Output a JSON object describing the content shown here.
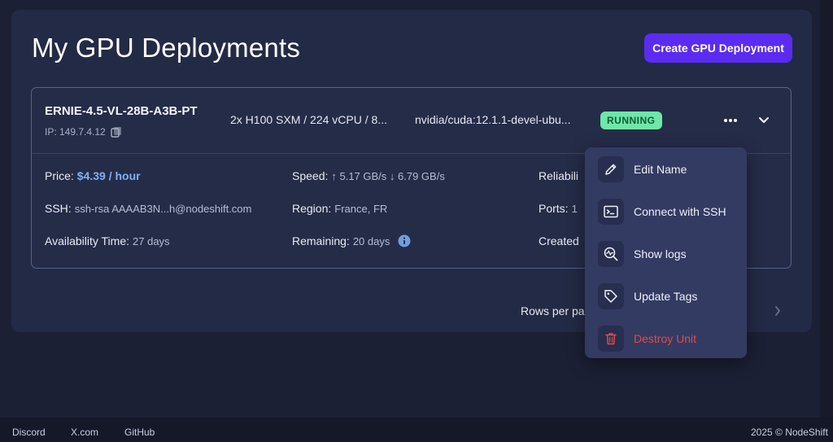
{
  "page": {
    "title": "My GPU Deployments",
    "create_button": "Create GPU Deployment"
  },
  "deployment": {
    "name": "ERNIE-4.5-VL-28B-A3B-PT",
    "ip": "IP: 149.7.4.12",
    "gpu_spec": "2x H100 SXM / 224 vCPU / 8...",
    "image": "nvidia/cuda:12.1.1-devel-ubu...",
    "status": "RUNNING",
    "status_color": "#6ee7a8",
    "price_label": "Price:",
    "price_value": "$4.39 / hour",
    "speed_label": "Speed:",
    "speed_value": "↑ 5.17 GB/s ↓ 6.79 GB/s",
    "reliability_label": "Reliabili",
    "ssh_label": "SSH:",
    "ssh_value": "ssh-rsa AAAAB3N...h@nodeshift.com",
    "region_label": "Region:",
    "region_value": "France, FR",
    "ports_label": "Ports:",
    "ports_value": "1",
    "availability_label": "Availability Time:",
    "availability_value": "27 days",
    "remaining_label": "Remaining:",
    "remaining_value": "20 days",
    "created_label": "Created"
  },
  "pagination": {
    "rows_per_page": "Rows per pa"
  },
  "context_menu": {
    "items": [
      {
        "label": "Edit Name",
        "icon": "pencil-icon"
      },
      {
        "label": "Connect with SSH",
        "icon": "terminal-icon"
      },
      {
        "label": "Show logs",
        "icon": "logs-search-icon"
      },
      {
        "label": "Update Tags",
        "icon": "tag-icon"
      },
      {
        "label": "Destroy Unit",
        "icon": "trash-icon"
      }
    ],
    "danger_color": "#e04a4a"
  },
  "footer": {
    "links": [
      "Discord",
      "X.com",
      "GitHub"
    ],
    "copyright": "2025 © NodeShift"
  },
  "theme": {
    "accent": "#5b2bf2",
    "price_color": "#7fb2f0"
  }
}
